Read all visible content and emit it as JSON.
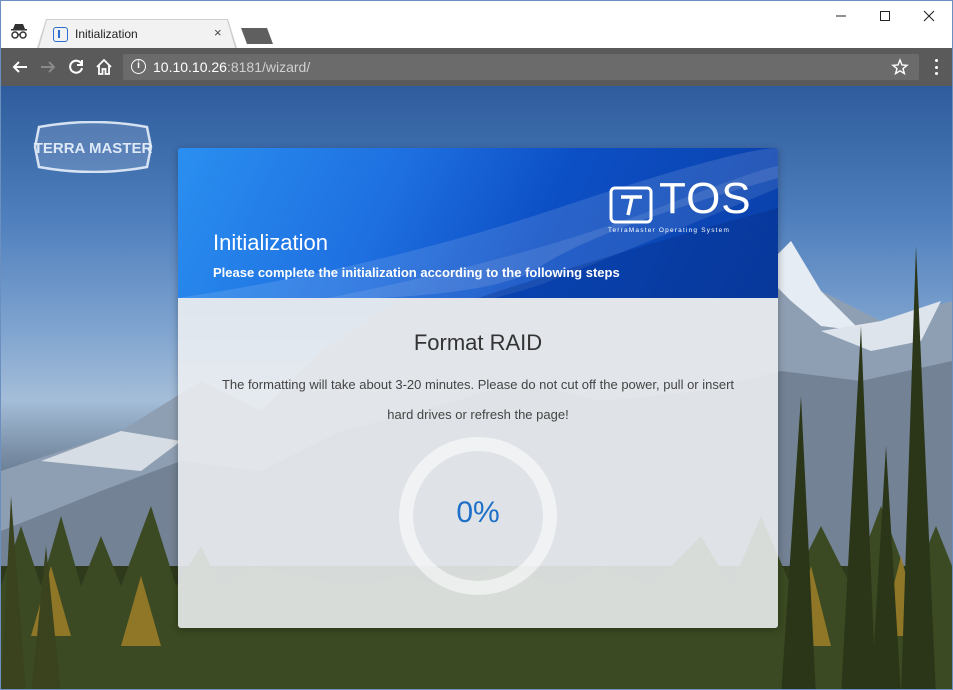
{
  "browser": {
    "tab_title": "Initialization",
    "tab_close": "×",
    "url_host": "10.10.10.26",
    "url_rest": ":8181/wizard/"
  },
  "brand": {
    "logo_text": "TERRA MASTER",
    "tos_text": "TOS",
    "tos_tagline": "TerraMaster Operating System"
  },
  "wizard": {
    "title": "Initialization",
    "subtitle": "Please complete the initialization according to the following steps",
    "step_heading": "Format RAID",
    "message": "The formatting will take about 3-20 minutes. Please do not cut off the power, pull or insert hard drives or refresh the page!",
    "progress_label": "0%",
    "progress_value": 0
  },
  "colors": {
    "accent": "#1e6fc8",
    "header_blue": "#1e6fe0"
  }
}
